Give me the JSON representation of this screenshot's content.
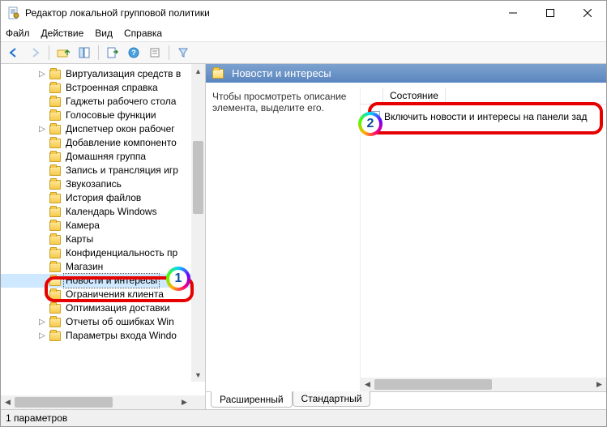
{
  "window": {
    "title": "Редактор локальной групповой политики"
  },
  "menu": {
    "file": "Файл",
    "action": "Действие",
    "view": "Вид",
    "help": "Справка"
  },
  "toolbar_icons": {
    "back": "back-arrow-icon",
    "forward": "forward-arrow-icon",
    "up": "up-folder-icon",
    "show_hide": "show-hide-tree-icon",
    "export": "export-list-icon",
    "help": "help-icon",
    "properties": "properties-icon",
    "filter": "filter-icon"
  },
  "tree": {
    "items": [
      {
        "label": "Виртуализация средств в",
        "expandable": true
      },
      {
        "label": "Встроенная справка"
      },
      {
        "label": "Гаджеты рабочего стола"
      },
      {
        "label": "Голосовые функции"
      },
      {
        "label": "Диспетчер окон рабочег",
        "expandable": true
      },
      {
        "label": "Добавление компоненто"
      },
      {
        "label": "Домашняя группа"
      },
      {
        "label": "Запись и трансляция игр"
      },
      {
        "label": "Звукозапись"
      },
      {
        "label": "История файлов"
      },
      {
        "label": "Календарь Windows"
      },
      {
        "label": "Камера"
      },
      {
        "label": "Карты"
      },
      {
        "label": "Конфиденциальность пр"
      },
      {
        "label": "Магазин"
      },
      {
        "label": "Новости и интересы",
        "selected": true,
        "open": true
      },
      {
        "label": "Ограничения клиента"
      },
      {
        "label": "Оптимизация доставки"
      },
      {
        "label": "Отчеты об ошибках Win",
        "expandable": true
      },
      {
        "label": "Параметры входа Windo",
        "expandable": true
      }
    ]
  },
  "detail": {
    "header": "Новости и интересы",
    "hint": "Чтобы просмотреть описание элемента, выделите его.",
    "columns": {
      "state": "Состояние"
    },
    "settings": [
      {
        "name": "Включить новости и интересы на панели зад"
      }
    ]
  },
  "tabs": {
    "extended": "Расширенный",
    "standard": "Стандартный"
  },
  "statusbar": {
    "count": "1 параметров"
  },
  "callouts": {
    "badge1": "1",
    "badge2": "2"
  }
}
